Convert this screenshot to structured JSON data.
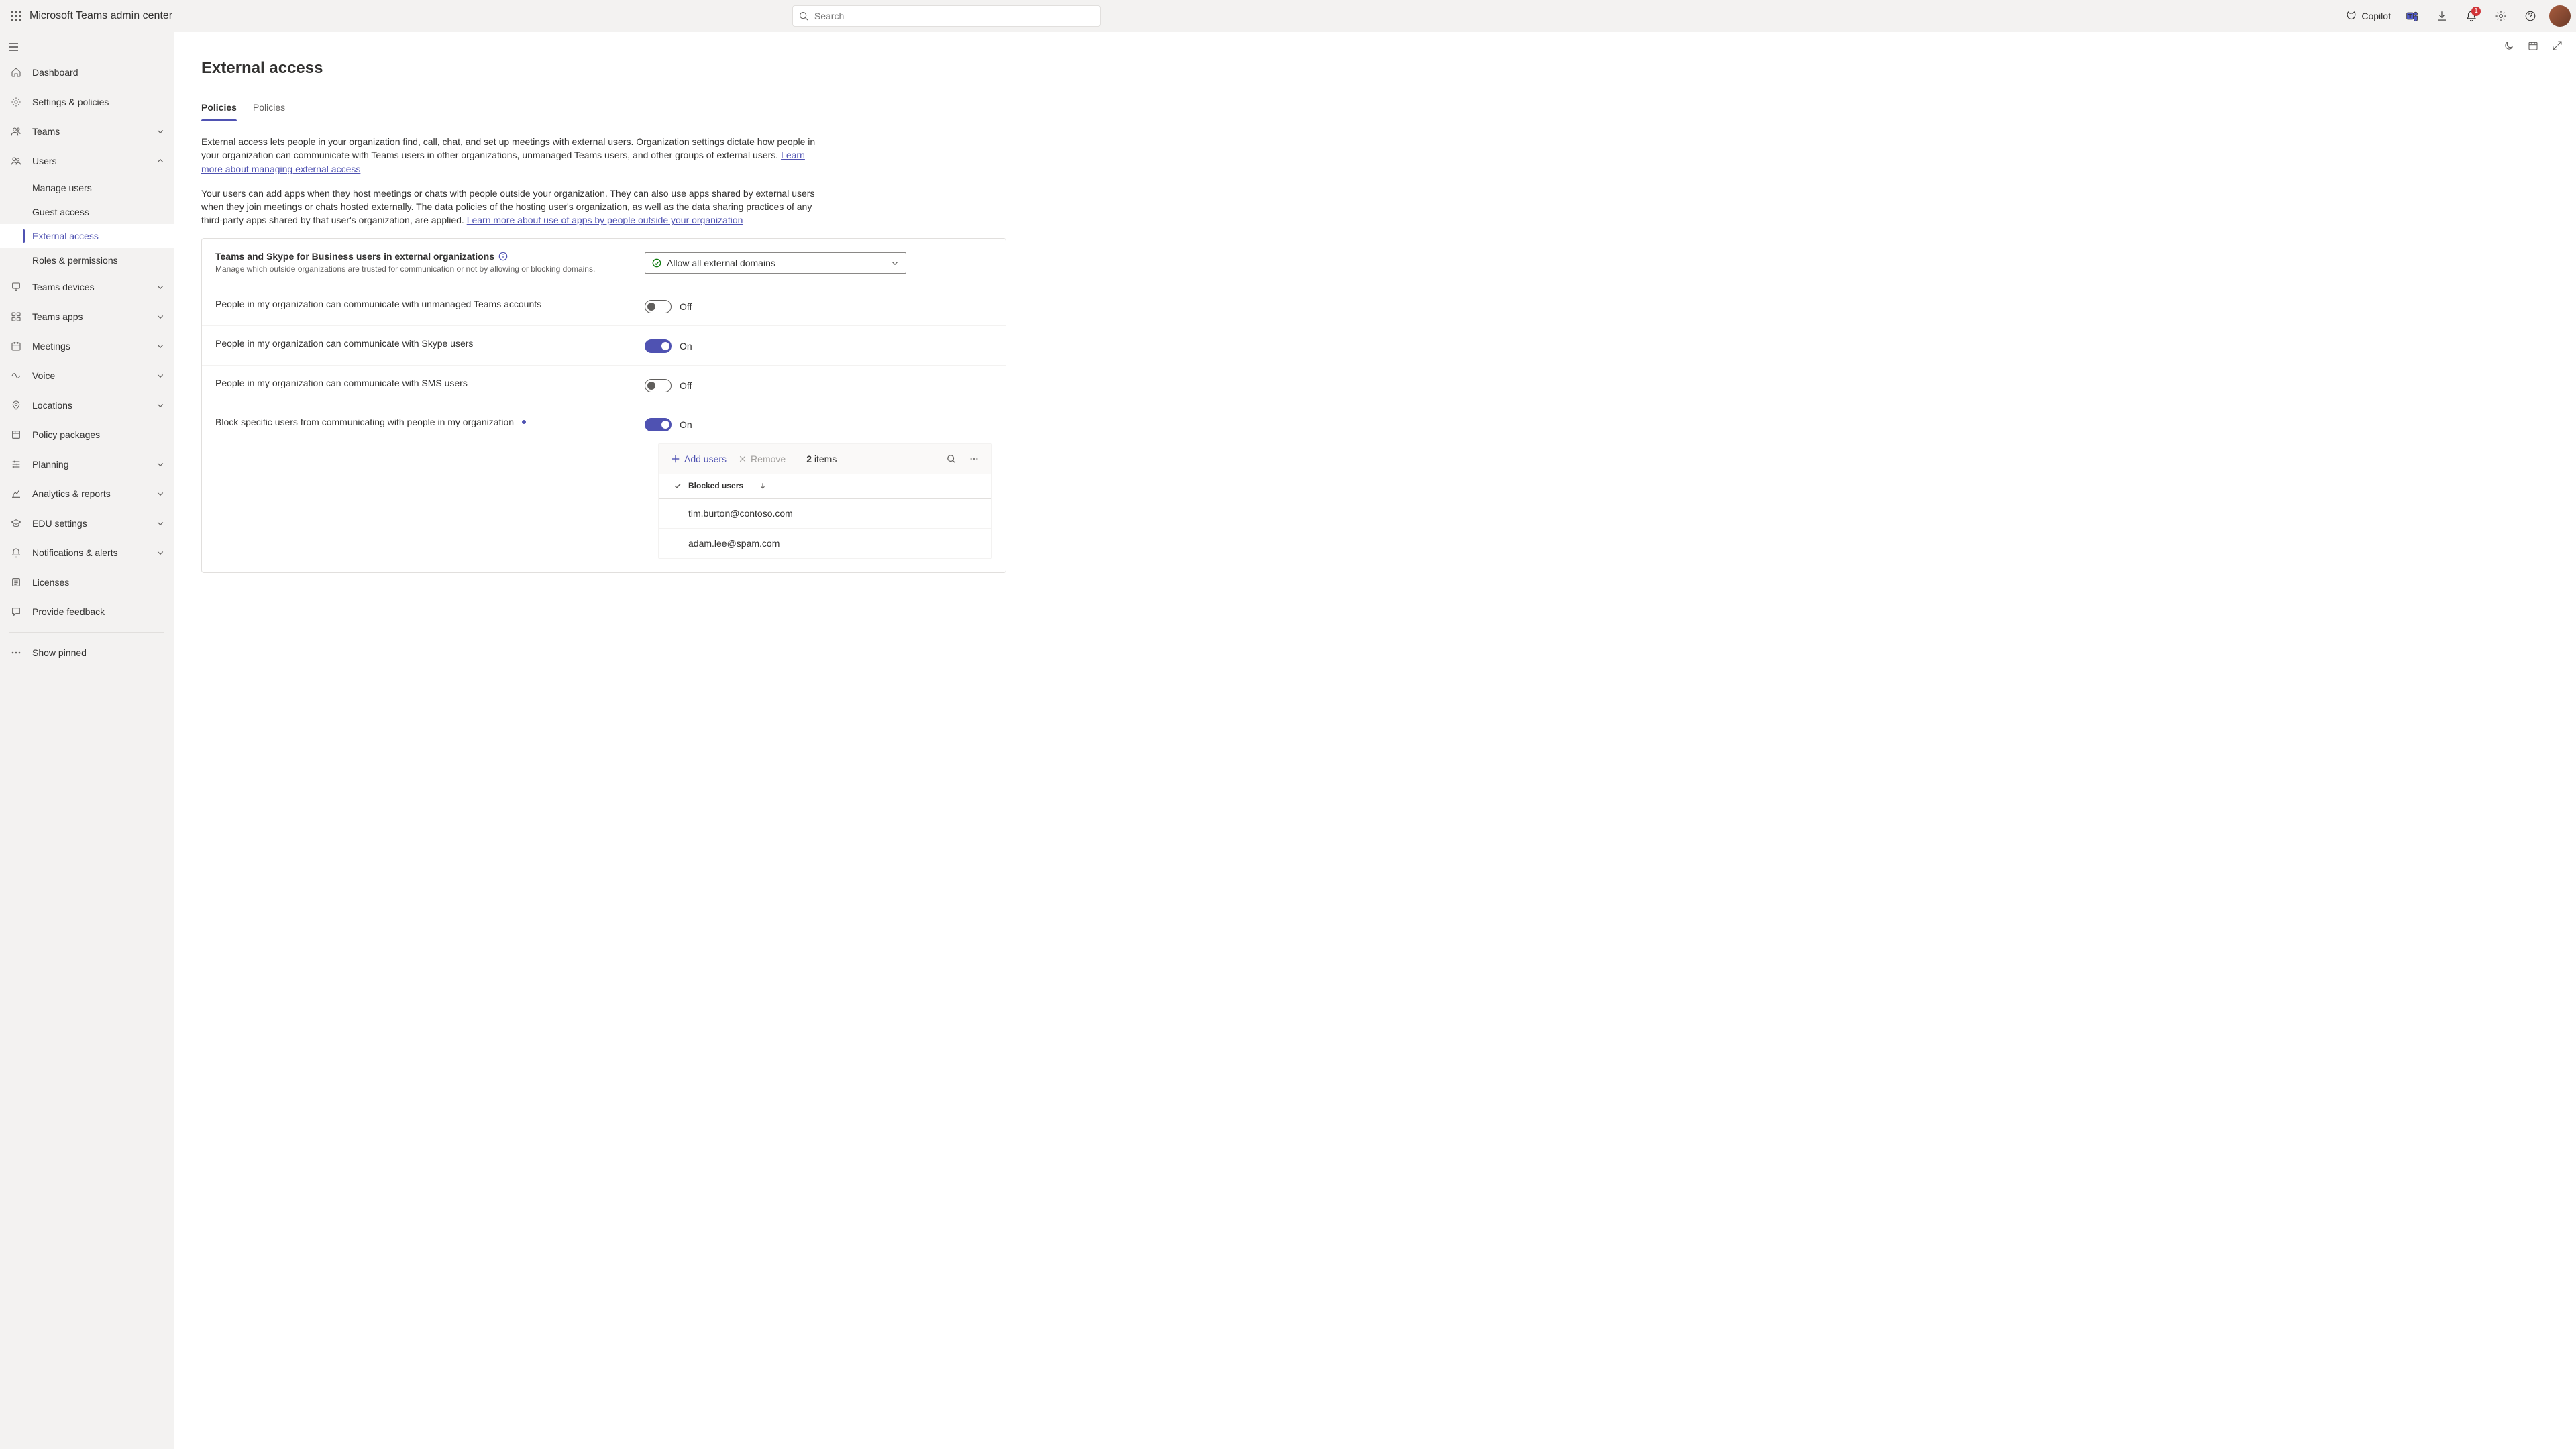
{
  "header": {
    "app_title": "Microsoft Teams admin center",
    "search_placeholder": "Search",
    "copilot_label": "Copilot",
    "notification_count": "1"
  },
  "sidebar": {
    "items": [
      {
        "label": "Dashboard",
        "icon": "home",
        "expandable": false
      },
      {
        "label": "Settings & policies",
        "icon": "gear",
        "expandable": false
      },
      {
        "label": "Teams",
        "icon": "people",
        "expandable": true
      },
      {
        "label": "Users",
        "icon": "persons",
        "expandable": true,
        "expanded": true,
        "children": [
          {
            "label": "Manage users"
          },
          {
            "label": "Guest access"
          },
          {
            "label": "External access",
            "active": true
          },
          {
            "label": "Roles & permissions"
          }
        ]
      },
      {
        "label": "Teams devices",
        "icon": "device",
        "expandable": true
      },
      {
        "label": "Teams apps",
        "icon": "apps",
        "expandable": true
      },
      {
        "label": "Meetings",
        "icon": "calendar",
        "expandable": true
      },
      {
        "label": "Voice",
        "icon": "voice",
        "expandable": true
      },
      {
        "label": "Locations",
        "icon": "location",
        "expandable": true
      },
      {
        "label": "Policy packages",
        "icon": "package",
        "expandable": false
      },
      {
        "label": "Planning",
        "icon": "planning",
        "expandable": true
      },
      {
        "label": "Analytics & reports",
        "icon": "analytics",
        "expandable": true
      },
      {
        "label": "EDU settings",
        "icon": "edu",
        "expandable": true
      },
      {
        "label": "Notifications & alerts",
        "icon": "bell",
        "expandable": true
      },
      {
        "label": "Licenses",
        "icon": "license",
        "expandable": false
      },
      {
        "label": "Provide feedback",
        "icon": "feedback",
        "expandable": false
      }
    ],
    "show_pinned": "Show pinned"
  },
  "page": {
    "title": "External access",
    "tabs": [
      {
        "label": "Policies",
        "active": true
      },
      {
        "label": "Policies",
        "active": false
      }
    ],
    "paragraph_a_text": "External access lets people in your organization find, call, chat, and set up meetings with external users. Organization settings dictate how people in your organization can communicate with Teams users in other organizations, unmanaged Teams users, and other groups of external users. ",
    "paragraph_a_link": "Learn more about managing external access",
    "paragraph_b_text": "Your users can add apps when they host meetings or chats with people outside your organization. They can also use apps shared by external users when they join meetings or chats hosted externally. The data policies of the hosting user's organization, as well as the data sharing practices of any third-party apps shared by that user's organization, are applied. ",
    "paragraph_b_link": "Learn more about use of apps by people outside your organization"
  },
  "settings": {
    "domain_row": {
      "title": "Teams and Skype for Business users in external organizations",
      "sub": "Manage which outside organizations are trusted for communication or not by allowing or blocking domains.",
      "select_value": "Allow all external domains"
    },
    "toggles": [
      {
        "title": "People in my organization can communicate with unmanaged Teams accounts",
        "on": false,
        "state": "Off"
      },
      {
        "title": "People in my organization can communicate with Skype users",
        "on": true,
        "state": "On"
      },
      {
        "title": "People in my organization can communicate with SMS users",
        "on": false,
        "state": "Off"
      }
    ],
    "block_row": {
      "title": "Block specific users from communicating with people in my organization",
      "on": true,
      "state": "On",
      "unsaved": true
    }
  },
  "blocked_table": {
    "add_label": "Add users",
    "remove_label": "Remove",
    "count_num": "2",
    "count_text": " items",
    "header": "Blocked users",
    "rows": [
      {
        "email": "tim.burton@contoso.com"
      },
      {
        "email": "adam.lee@spam.com"
      }
    ]
  }
}
